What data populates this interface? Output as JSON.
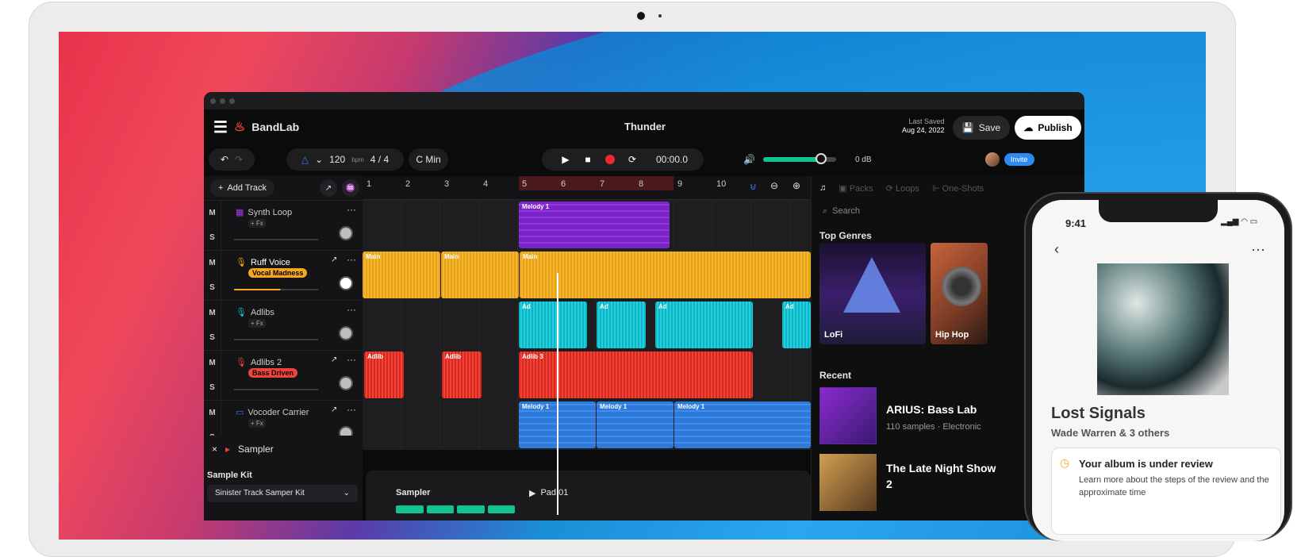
{
  "header": {
    "brand": "BandLab",
    "song_title": "Thunder",
    "last_saved_label": "Last Saved",
    "last_saved_date": "Aug 24, 2022",
    "save": "Save",
    "publish": "Publish"
  },
  "toolbar": {
    "tempo": "120",
    "tempo_unit": "bpm",
    "time_sig_num": "4",
    "time_sig_den": "4",
    "key": "C Min",
    "time": "00:00.0",
    "volume_db": "0 dB",
    "volume_level": 0.78,
    "invite": "Invite"
  },
  "tracks": {
    "add_track": "Add Track",
    "mute": "M",
    "solo": "S",
    "items": [
      {
        "name": "Synth Loop",
        "fx": "+ Fx"
      },
      {
        "name": "Ruff Voice",
        "fx": "Vocal Madness"
      },
      {
        "name": "Adlibs",
        "fx": "+ Fx"
      },
      {
        "name": "Adlibs  2",
        "fx": "Bass Driven"
      },
      {
        "name": "Vocoder Carrier",
        "fx": "+ Fx"
      }
    ]
  },
  "ruler": [
    "1",
    "2",
    "3",
    "4",
    "5",
    "6",
    "7",
    "8",
    "9",
    "10"
  ],
  "clips": {
    "melody": "Melody 1",
    "main": "Main",
    "ad": "Ad",
    "adlib": "Adlib",
    "adlib3": "Adlib 3"
  },
  "sampler": {
    "close": "×",
    "label": "Sampler",
    "kit_heading": "Sample Kit",
    "kit_value": "Sinister Track Samper Kit",
    "panel_title": "Sampler",
    "pad": "Pad 01"
  },
  "browser": {
    "tabs": [
      "Packs",
      "Loops",
      "One-Shots"
    ],
    "search_placeholder": "Search",
    "top_genres": "Top Genres",
    "genres": [
      "LoFi",
      "Hip Hop"
    ],
    "recent": "Recent",
    "recent_items": [
      {
        "title": "ARIUS: Bass Lab",
        "samples": "110 samples",
        "genre": "Electronic"
      },
      {
        "title": "The Late Night Show 2"
      }
    ]
  },
  "phone": {
    "time": "9:41",
    "album": "Lost Signals",
    "artist": "Wade Warren & 3 others",
    "review_title": "Your album is under review",
    "review_body": "Learn more about the steps of the review and the approximate time"
  }
}
